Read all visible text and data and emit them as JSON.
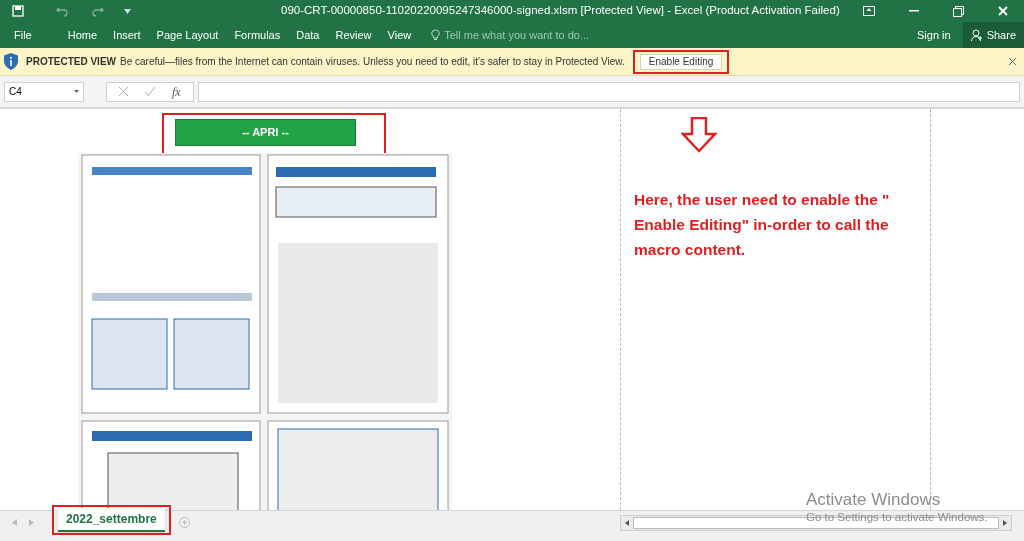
{
  "window": {
    "title": "090-CRT-00000850-11020220095247346000-signed.xlsm  [Protected View] - Excel (Product Activation Failed)"
  },
  "ribbon": {
    "tabs": [
      {
        "label": "File",
        "selected": false
      },
      {
        "label": "Home",
        "selected": false
      },
      {
        "label": "Insert",
        "selected": false
      },
      {
        "label": "Page Layout",
        "selected": false
      },
      {
        "label": "Formulas",
        "selected": false
      },
      {
        "label": "Data",
        "selected": false
      },
      {
        "label": "Review",
        "selected": false
      },
      {
        "label": "View",
        "selected": false
      }
    ],
    "tell_me": "Tell me what you want to do...",
    "sign_in": "Sign in",
    "share": "Share"
  },
  "protected_bar": {
    "title": "PROTECTED VIEW",
    "message": "Be careful—files from the Internet can contain viruses. Unless you need to edit, it's safer to stay in Protected View.",
    "button": "Enable Editing"
  },
  "formula_bar": {
    "name_box": "C4",
    "fx": "fx"
  },
  "sheet": {
    "button": "-- APRI --",
    "annotation": "Here, the user need to enable the \" Enable Editing\" in-order to call the macro content."
  },
  "sheet_tabs": [
    {
      "label": "2022_settembre",
      "selected": true
    }
  ],
  "activation": {
    "title": "Activate Windows",
    "message": "Go to Settings to activate Windows."
  }
}
